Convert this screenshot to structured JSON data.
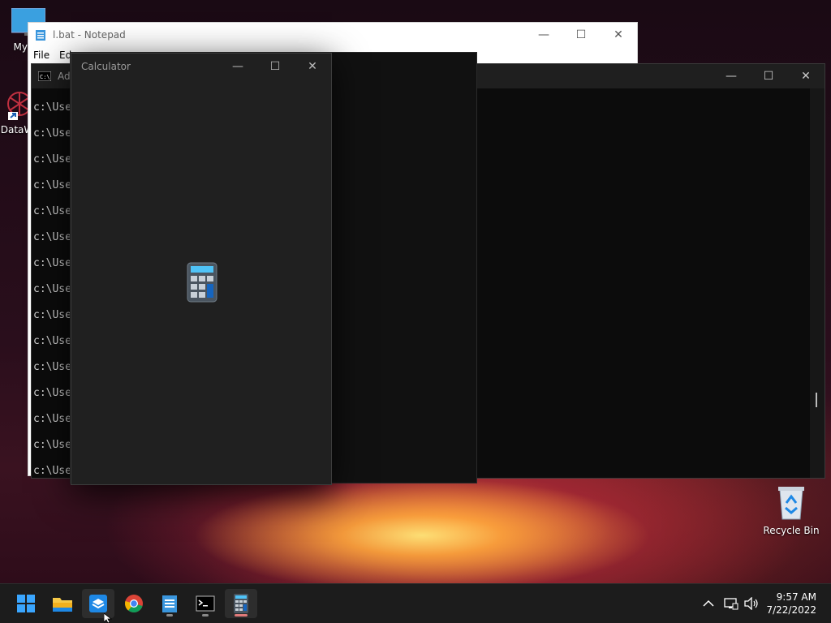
{
  "desktop": {
    "icons": [
      {
        "label": "My Co"
      },
      {
        "label": "DataW"
      },
      {
        "label": "Recycle Bin"
      }
    ]
  },
  "notepad": {
    "title": "l.bat - Notepad",
    "menu": [
      "File",
      "Ed"
    ]
  },
  "console": {
    "title": "Adr",
    "lines": [
      "c:\\Use",
      "c:\\Use",
      "c:\\Use",
      "c:\\Use",
      "c:\\Use",
      "c:\\Use",
      "c:\\Use",
      "c:\\Use",
      "c:\\Use",
      "c:\\Use",
      "c:\\Use",
      "c:\\Use",
      "c:\\Use",
      "c:\\Use",
      "c:\\Use"
    ]
  },
  "calculator": {
    "title": "Calculator"
  },
  "window_controls": {
    "minimize": "—",
    "maximize": "☐",
    "close": "✕"
  },
  "taskbar": {
    "icons": [
      "start-icon",
      "file-explorer-icon",
      "app-installer-icon",
      "chrome-icon",
      "notepad-icon",
      "terminal-icon",
      "calculator-icon"
    ],
    "clock_time": "9:57 AM",
    "clock_date": "7/22/2022",
    "tray_chevron": "^"
  },
  "colors": {
    "accent": "#0078d4",
    "calculator_bg": "#202020",
    "console_bg": "#0c0c0c"
  }
}
